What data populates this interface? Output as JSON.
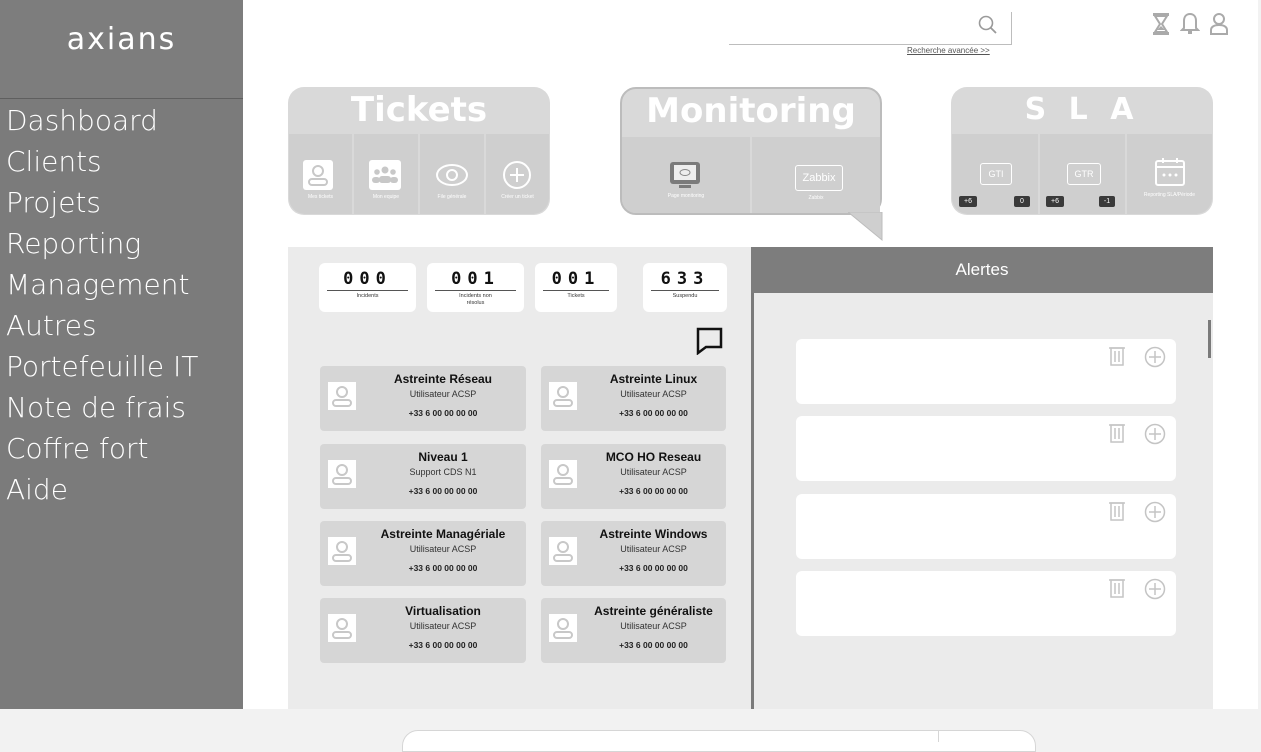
{
  "brand": {
    "logo_text": "axians"
  },
  "sidebar": {
    "items": [
      {
        "label": "Dashboard"
      },
      {
        "label": "Clients"
      },
      {
        "label": "Projets"
      },
      {
        "label": "Reporting"
      },
      {
        "label": "Management"
      },
      {
        "label": "Autres"
      },
      {
        "label": "Portefeuille IT"
      },
      {
        "label": "Note de frais"
      },
      {
        "label": "Coffre fort"
      },
      {
        "label": "Aide"
      }
    ]
  },
  "header": {
    "search": {
      "value": "",
      "placeholder": ""
    },
    "advanced_search": "Recherche avancée >>",
    "icons": [
      "hourglass-icon",
      "bell-icon",
      "user-icon"
    ]
  },
  "tickets_card": {
    "title": "Tickets",
    "tiles": [
      {
        "icon": "user-icon",
        "caption": "Mes tickets"
      },
      {
        "icon": "team-icon",
        "caption": "Mon equipe"
      },
      {
        "icon": "eye-icon",
        "caption": "File générale"
      },
      {
        "icon": "plus-circle-icon",
        "caption": "Créer un ticket"
      }
    ]
  },
  "monitoring_card": {
    "title": "Monitoring",
    "tiles": [
      {
        "icon": "monitor-icon",
        "caption": "Page monitoring"
      },
      {
        "label": "Zabbix",
        "caption": "Zabbix"
      }
    ]
  },
  "sla_card": {
    "title": "S L A",
    "tiles": [
      {
        "label": "GTI",
        "badge_left": "+6",
        "badge_right": "0"
      },
      {
        "label": "GTR",
        "badge_left": "+6",
        "badge_right": "-1"
      },
      {
        "icon": "calendar-icon",
        "caption": "Reporting SLA/Période"
      }
    ]
  },
  "counters": [
    {
      "value": "000",
      "label": "Incidents"
    },
    {
      "value": "001",
      "label": "Incidents non résolus"
    },
    {
      "value": "001",
      "label": "Tickets"
    },
    {
      "value": "633",
      "label": "Suspendu"
    }
  ],
  "contacts": [
    {
      "name": "Astreinte Réseau",
      "role": "Utilisateur ACSP",
      "phone": "+33 6 00 00 00 00"
    },
    {
      "name": "Astreinte Linux",
      "role": "Utilisateur ACSP",
      "phone": "+33 6 00 00 00 00"
    },
    {
      "name": "Niveau 1",
      "role": "Support CDS N1",
      "phone": "+33 6 00 00 00 00"
    },
    {
      "name": "MCO HO Reseau",
      "role": "Utilisateur ACSP",
      "phone": "+33 6 00 00 00 00"
    },
    {
      "name": "Astreinte Managériale",
      "role": "Utilisateur ACSP",
      "phone": "+33 6 00 00 00 00"
    },
    {
      "name": "Astreinte Windows",
      "role": "Utilisateur ACSP",
      "phone": "+33 6 00 00 00 00"
    },
    {
      "name": "Virtualisation",
      "role": "Utilisateur ACSP",
      "phone": "+33 6 00 00 00 00"
    },
    {
      "name": "Astreinte généraliste",
      "role": "Utilisateur ACSP",
      "phone": "+33 6 00 00 00 00"
    }
  ],
  "alerts": {
    "title": "Alertes",
    "items": [
      {
        "text": ""
      },
      {
        "text": ""
      },
      {
        "text": ""
      },
      {
        "text": ""
      }
    ]
  },
  "colors": {
    "sidebar": "#7b7b7b",
    "card": "#d9d9d9",
    "alerts_header": "#7d7d7d",
    "panel": "#ebebeb"
  }
}
